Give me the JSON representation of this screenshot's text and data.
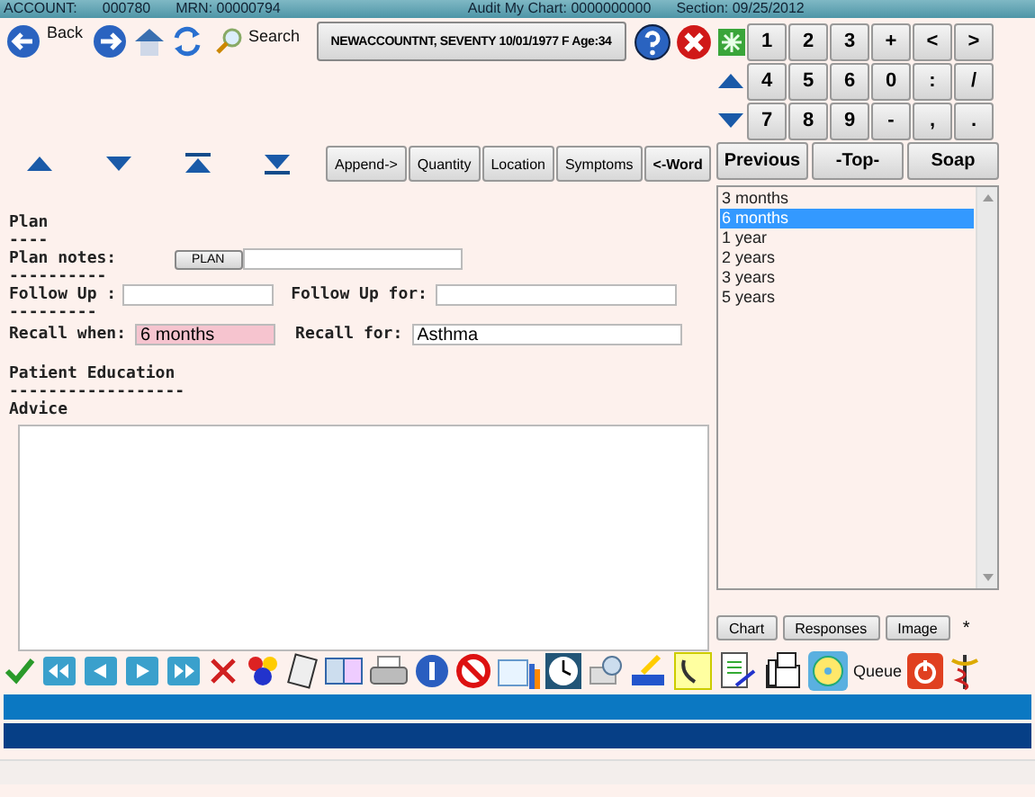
{
  "header": {
    "account": "ACCOUNT:",
    "account_no": "000780",
    "mrn": "MRN: 00000794",
    "audit": "Audit My Chart: 0000000000",
    "section": "Section: 09/25/2012"
  },
  "toolbar": {
    "back": "Back",
    "search": "Search",
    "patient": "NEWACCOUNTNT, SEVENTY 10/01/1977 F Age:34"
  },
  "keypad": [
    [
      "1",
      "2",
      "3",
      "+",
      "<",
      ">"
    ],
    [
      "4",
      "5",
      "6",
      "0",
      ":",
      "/"
    ],
    [
      "7",
      "8",
      "9",
      "-",
      ",",
      "."
    ]
  ],
  "nav_buttons": [
    "Previous",
    "-Top-",
    "Soap"
  ],
  "edit_buttons": [
    "Append->",
    "Quantity",
    "Location",
    "Symptoms",
    "<-Word"
  ],
  "form": {
    "plan": "Plan",
    "plan_rule": "----",
    "plan_notes": "Plan notes:",
    "plan_button": "PLAN",
    "plan_rule2": "----------",
    "follow_up": "Follow Up :",
    "follow_up_for": "Follow Up for:",
    "follow_up_rule": "---------",
    "recall_when": "Recall when:",
    "recall_when_value": "6 months",
    "recall_for": "Recall for:",
    "recall_for_value": "Asthma",
    "education": "Patient Education",
    "education_rule": "------------------",
    "advice": "Advice"
  },
  "list": [
    {
      "label": "3 months",
      "selected": false
    },
    {
      "label": "6 months",
      "selected": true
    },
    {
      "label": "1 year",
      "selected": false
    },
    {
      "label": "2 years",
      "selected": false
    },
    {
      "label": "3 years",
      "selected": false
    },
    {
      "label": "5 years",
      "selected": false
    }
  ],
  "side_buttons": [
    "Chart",
    "Responses",
    "Image"
  ],
  "asterisk": "*",
  "queue": "Queue"
}
